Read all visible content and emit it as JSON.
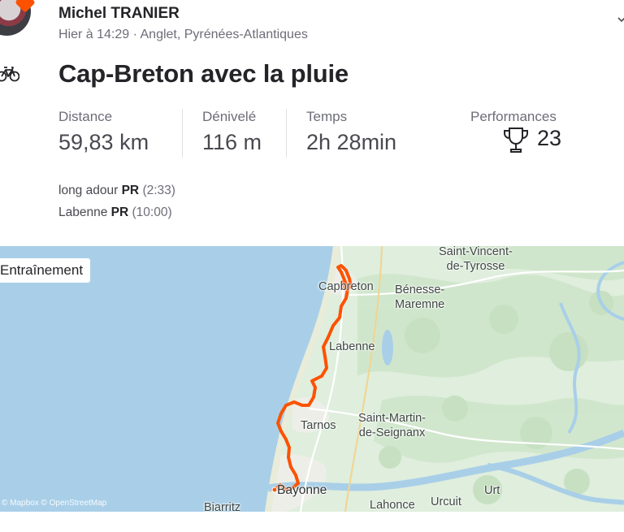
{
  "athlete": {
    "name": "Michel TRANIER",
    "meta": "Hier à 14:29 · Anglet, Pyrénées-Atlantiques"
  },
  "activity": {
    "title": "Cap-Breton avec la pluie",
    "type_icon": "bike-icon"
  },
  "stats": [
    {
      "label": "Distance",
      "value": "59,83 km"
    },
    {
      "label": "Dénivelé",
      "value": "116 m"
    },
    {
      "label": "Temps",
      "value": "2h 28min"
    }
  ],
  "performances": {
    "label": "Performances",
    "count": "23",
    "icon": "trophy-icon"
  },
  "achievements": [
    {
      "segment": "long adour",
      "badge": "PR",
      "time": "(2:33)"
    },
    {
      "segment": "Labenne",
      "badge": "PR",
      "time": "(10:00)"
    }
  ],
  "map": {
    "tag": "Entraînement",
    "places": {
      "saint_vincent": "Saint-Vincent-\nde-Tyrosse",
      "capbreton": "Capbreton",
      "benesse": "Bénesse-\nMaremne",
      "labenne": "Labenne",
      "saint_martin": "Saint-Martin-\nde-Seignanx",
      "tarnos": "Tarnos",
      "bayonne": "Bayonne",
      "biarritz": "Biarritz",
      "lahonce": "Lahonce",
      "urcuit": "Urcuit",
      "urt": "Urt"
    },
    "attribution": "© Mapbox © OpenStreetMap",
    "route_color": "#fc5200",
    "ocean_color": "#a9cfe8"
  }
}
